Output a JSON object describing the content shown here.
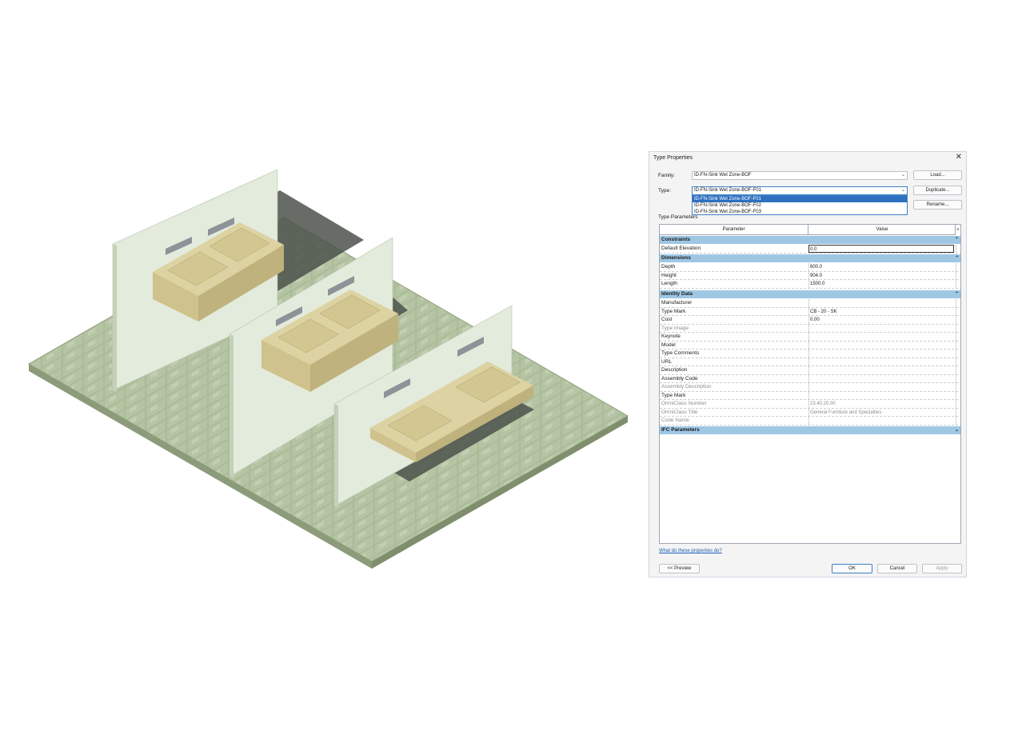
{
  "dialog": {
    "title": "Type Properties",
    "family_label": "Family:",
    "family_value": "ID-FN-Sink Wet Zone-BOF",
    "type_label": "Type:",
    "type_value": "ID-FN-Sink Wet Zone-BOF-F01",
    "type_options": [
      "ID-FN-Sink Wet Zone-BOF-F01",
      "ID-FN-Sink Wet Zone-BOF-F02",
      "ID-FN-Sink Wet Zone-BOF-F03"
    ],
    "load_label": "Load...",
    "duplicate_label": "Duplicate...",
    "rename_label": "Rename...",
    "type_parameters_label": "Type Parameters",
    "columns": {
      "parameter": "Parameter",
      "value": "Value"
    },
    "groups": {
      "constraints": "Constraints",
      "dimensions": "Dimensions",
      "identity": "Identity Data",
      "ifc": "IFC Parameters"
    },
    "rows": {
      "default_elevation": {
        "name": "Default Elevation",
        "value": "0.0"
      },
      "depth": {
        "name": "Depth",
        "value": "600.0"
      },
      "height": {
        "name": "Height",
        "value": "904.0"
      },
      "length": {
        "name": "Length",
        "value": "1500.0"
      },
      "manufacturer": {
        "name": "Manufacturer",
        "value": ""
      },
      "type_mark": {
        "name": "Type Mark",
        "value": "CB - 20 - SK"
      },
      "cost": {
        "name": "Cost",
        "value": "0.00"
      },
      "type_image": {
        "name": "Type Image",
        "value": ""
      },
      "keynote": {
        "name": "Keynote",
        "value": ""
      },
      "model": {
        "name": "Model",
        "value": ""
      },
      "type_comments": {
        "name": "Type Comments",
        "value": ""
      },
      "url": {
        "name": "URL",
        "value": ""
      },
      "description": {
        "name": "Description",
        "value": ""
      },
      "assembly_code": {
        "name": "Assembly Code",
        "value": ""
      },
      "assembly_description": {
        "name": "Assembly Description",
        "value": ""
      },
      "type_mark_2": {
        "name": "Type Mark",
        "value": ""
      },
      "omniclass_number": {
        "name": "OmniClass Number",
        "value": "23.40.20.00"
      },
      "omniclass_title": {
        "name": "OmniClass Title",
        "value": "General Furniture and Specialties"
      },
      "code_name": {
        "name": "Code Name",
        "value": ""
      }
    },
    "help_link": "What do these properties do?",
    "preview_label": "<< Preview",
    "ok_label": "OK",
    "cancel_label": "Cancel",
    "apply_label": "Apply",
    "accent_color": "#3c7fc4",
    "group_color": "#9fc7e4"
  },
  "scene": {
    "floor_color": "#a9bb96",
    "partition_color": "#e3ebdc",
    "vanity_color": "#d8cc98",
    "shadow_color": "#4a4f49"
  }
}
